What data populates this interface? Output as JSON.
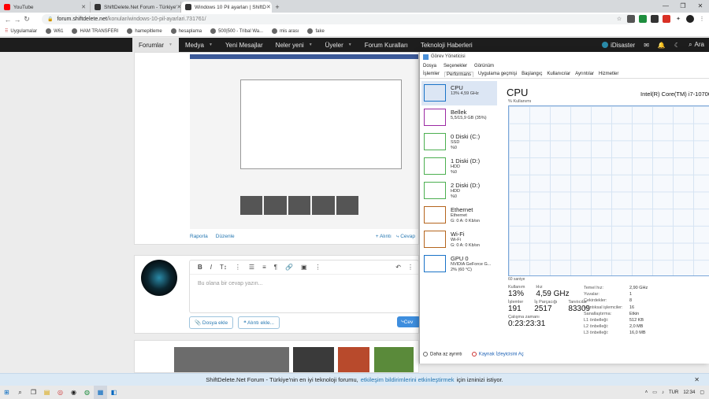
{
  "browser": {
    "tabs": [
      {
        "title": "YouTube",
        "color": "#ff0000"
      },
      {
        "title": "ShiftDelete.Net Forum - Türkiye'",
        "color": "#333333"
      },
      {
        "title": "Windows 10 Pil ayarları | ShiftD",
        "color": "#333333"
      }
    ],
    "url_domain": "forum.shiftdelete.net",
    "url_path": "/konular/windows-10-pil-ayarlari.731761/",
    "bookmarks": [
      "Uygulamalar",
      "W61",
      "HAM TRANSFERI",
      "hamepitleme",
      "hesaplama",
      "500|500 - Tribal Wa...",
      "mis arası",
      "fake"
    ]
  },
  "site": {
    "nav": [
      "Forumlar",
      "Medya",
      "Yeni Mesajlar",
      "Neler yeni",
      "Üyeler",
      "Forum Kuralları",
      "Teknoloji Haberleri"
    ],
    "user": "iDisaster",
    "search": "Ara"
  },
  "post": {
    "report": "Raporla",
    "edit": "Düzenle",
    "like": "Alıntı",
    "quote": "Cevap"
  },
  "reply": {
    "placeholder": "Bu olana bir cevap yazın...",
    "attach": "Dosya ekle",
    "quote_btn": "Alıntı ekle...",
    "submit": "Cev"
  },
  "notice": {
    "text1": "ShiftDelete.Net Forum - Türkiye'nin en iyi teknoloji forumu,",
    "link": "etkileşim bildirimlerini etkinleştirmek",
    "text2": "için izninizi istiyor."
  },
  "taskbar": {
    "lang": "TUR",
    "time": "12:34"
  },
  "taskmgr": {
    "title": "Görev Yöneticisi",
    "menu": [
      "Dosya",
      "Seçenekler",
      "Görünüm"
    ],
    "tabs": [
      "İşlemler",
      "Performans",
      "Uygulama geçmişi",
      "Başlangıç",
      "Kullanıcılar",
      "Ayrıntılar",
      "Hizmetler"
    ],
    "resources": [
      {
        "name": "CPU",
        "sub": "13%  4,59 GHz",
        "sub2": "",
        "sub3": "",
        "color": "#1a73c8"
      },
      {
        "name": "Bellek",
        "sub": "5,5/15,9 GB (35%)",
        "sub2": "",
        "sub3": "",
        "color": "#9b2aa3"
      },
      {
        "name": "0 Diski (C:)",
        "sub": "SSD",
        "sub2": "%0",
        "sub3": "",
        "color": "#4caf50"
      },
      {
        "name": "1 Diski (D:)",
        "sub": "HDD",
        "sub2": "%0",
        "sub3": "",
        "color": "#4caf50"
      },
      {
        "name": "2 Diski (D:)",
        "sub": "HDD",
        "sub2": "%0",
        "sub3": "",
        "color": "#4caf50"
      },
      {
        "name": "Ethernet",
        "sub": "Ethernet",
        "sub2": "G: 0  A: 0 Kb/sn",
        "sub3": "",
        "color": "#b5651d"
      },
      {
        "name": "Wi-Fi",
        "sub": "Wi-Fi",
        "sub2": "G: 0  A: 0 Kb/sn",
        "sub3": "",
        "color": "#b5651d"
      },
      {
        "name": "GPU 0",
        "sub": "NVIDIA GeForce G...",
        "sub2": "2% (60 °C)",
        "sub3": "",
        "color": "#1a73c8"
      }
    ],
    "cpu_title": "CPU",
    "cpu_model": "Intel(R) Core(TM) i7-10700",
    "graph_label": "% Kullanımı",
    "graph_time": "60 saniye",
    "stats": {
      "util_label": "Kullanım",
      "util": "13%",
      "speed_label": "Hız",
      "speed": "4,59 GHz",
      "proc_label": "İşlemler",
      "proc": "191",
      "thr_label": "İş Parçacığı",
      "thr": "2517",
      "hnd_label": "Tanıtıcılar",
      "hnd": "83309",
      "up_label": "Çalışma zamanı",
      "up": "0:23:23:31"
    },
    "specs": [
      {
        "k": "Temel hız:",
        "v": "2,90 GHz"
      },
      {
        "k": "Yuvalar:",
        "v": "1"
      },
      {
        "k": "Çekirdekler:",
        "v": "8"
      },
      {
        "k": "Mantıksal işlemciler:",
        "v": "16"
      },
      {
        "k": "Sanallaştırma:",
        "v": "Etkin"
      },
      {
        "k": "L1 önbelleği:",
        "v": "512 KB"
      },
      {
        "k": "L2 önbelleği:",
        "v": "2,0 MB"
      },
      {
        "k": "L3 önbelleği:",
        "v": "16,0 MB"
      }
    ],
    "footer_less": "Daha az ayrıntı",
    "footer_monitor": "Kaynak İzleyicisini Aç"
  }
}
